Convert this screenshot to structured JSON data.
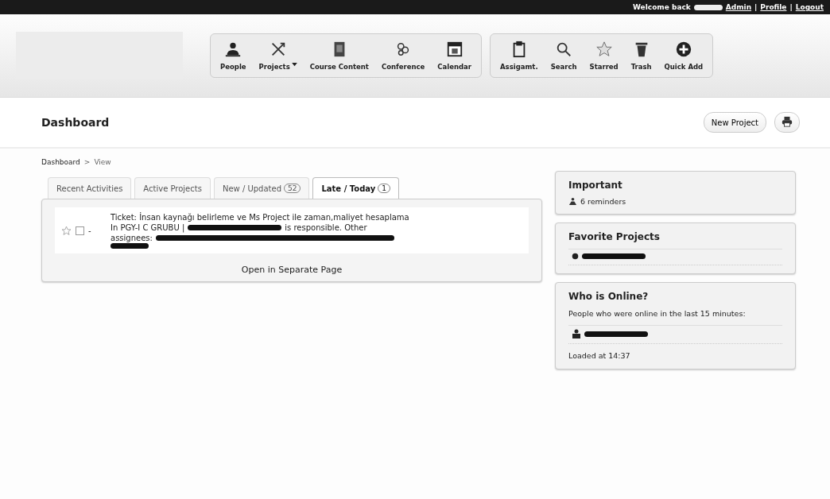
{
  "top_bar": {
    "welcome": "Welcome back",
    "links": [
      "Admin",
      "Profile",
      "Logout"
    ]
  },
  "toolbar": {
    "groups": [
      [
        {
          "label": "People",
          "dropdown": false
        },
        {
          "label": "Projects",
          "dropdown": true
        },
        {
          "label": "Course Content",
          "dropdown": false
        },
        {
          "label": "Conference",
          "dropdown": false
        },
        {
          "label": "Calendar",
          "dropdown": false
        }
      ],
      [
        {
          "label": "Assigamt.",
          "dropdown": false
        },
        {
          "label": "Search",
          "dropdown": false
        },
        {
          "label": "Starred",
          "dropdown": false
        },
        {
          "label": "Trash",
          "dropdown": false
        },
        {
          "label": "Quick Add",
          "dropdown": false
        }
      ]
    ]
  },
  "page": {
    "title": "Dashboard",
    "new_project": "New Project"
  },
  "breadcrumb": [
    "Dashboard",
    "View"
  ],
  "breadcrumb_separator": ">",
  "link_separator": "|",
  "tabs": [
    {
      "label": "Recent Activities",
      "selected": false
    },
    {
      "label": "Active Projects",
      "selected": false
    },
    {
      "label": "New / Updated",
      "count": "52",
      "selected": false
    },
    {
      "label": "Late / Today",
      "count": "1",
      "selected": true
    }
  ],
  "ticket": {
    "title": "Ticket: İnsan kaynağı belirleme ve Ms Project ile zaman,maliyet hesaplama",
    "project": "In PGY-I C GRUBU |",
    "responsible": "is responsible. Other",
    "assignees": "assignees:",
    "starred": false,
    "checked": false,
    "dash": "-"
  },
  "open_link": "Open in Separate Page",
  "important": {
    "title": "Important",
    "reminders": "6 reminders"
  },
  "favorites": {
    "title": "Favorite Projects"
  },
  "online": {
    "title": "Who is Online?",
    "text": "People who were online in the last 15 minutes:",
    "loaded": "Loaded at 14:37"
  }
}
